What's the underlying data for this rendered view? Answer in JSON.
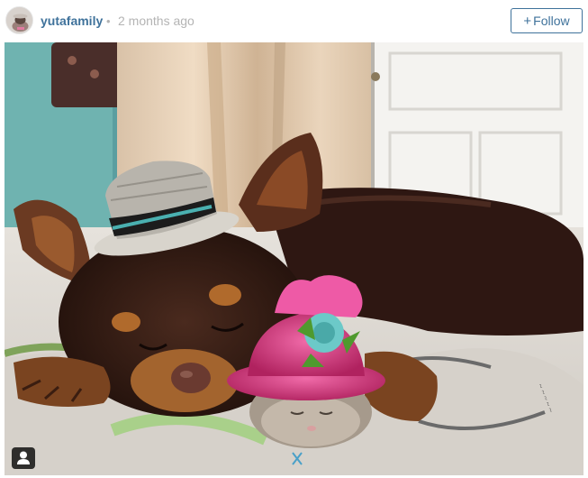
{
  "post": {
    "username": "yutafamily",
    "separator": "•",
    "timestamp": "2 months ago",
    "follow_label": "Follow",
    "follow_icon": "plus-icon",
    "avatar_icon": "avatar",
    "photo_subject": "photo",
    "tag_icon": "user-tag-icon"
  },
  "colors": {
    "link_blue": "#3f729b",
    "muted_gray": "#b4b4b4"
  }
}
